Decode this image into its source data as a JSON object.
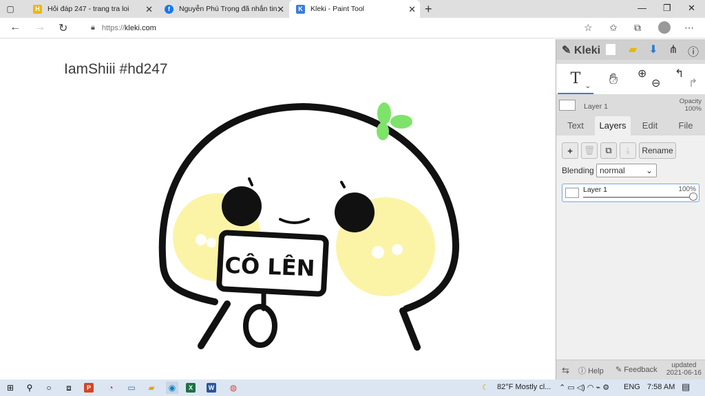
{
  "browser": {
    "tabs": [
      {
        "title": "Hỏi đáp 247 - trang tra loi",
        "favicon": "H",
        "color": "#f2b705"
      },
      {
        "title": "Nguyễn Phú Trọng đã nhắn tin F",
        "favicon": "f",
        "color": "#1877f2"
      },
      {
        "title": "Kleki - Paint Tool",
        "favicon": "K",
        "color": "#3b7ddd"
      }
    ],
    "url_proto": "https://",
    "url_host": "kleki.com"
  },
  "canvas": {
    "text": "IamShiii #hd247",
    "sign_text": "CÔ LÊN"
  },
  "panel": {
    "logo": "Kleki",
    "tool_text_glyph": "T",
    "layer_mini_name": "Layer 1",
    "opacity_label": "Opacity",
    "opacity_value": "100%",
    "tabs": [
      "Text",
      "Layers",
      "Edit",
      "File"
    ],
    "rename_label": "Rename",
    "blending_label": "Blending",
    "blending_value": "normal",
    "layer_name": "Layer 1",
    "layer_opacity": "100%",
    "footer": {
      "help": "Help",
      "feedback": "Feedback",
      "updated_label": "updated",
      "updated_date": "2021-06-16"
    }
  },
  "taskbar": {
    "weather": "82°F  Mostly cl...",
    "lang": "ENG",
    "time": "7:58 AM"
  }
}
